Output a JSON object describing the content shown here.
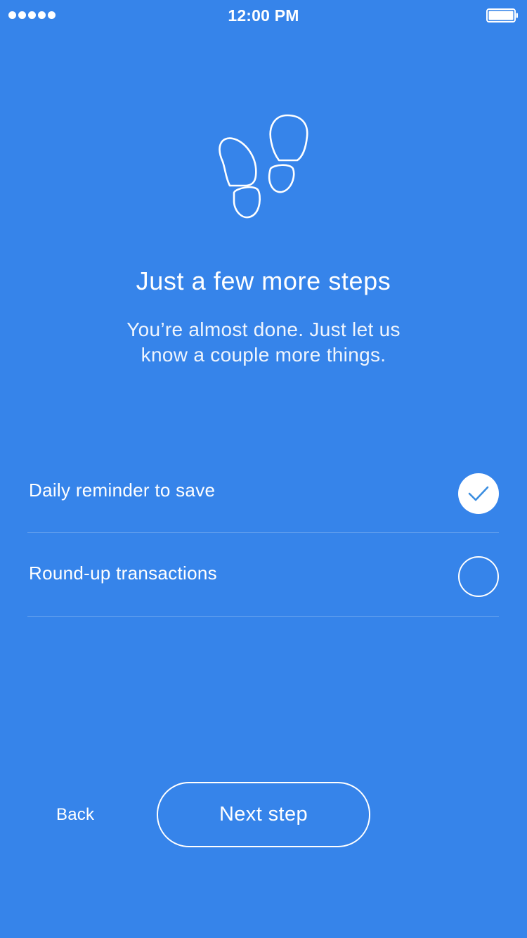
{
  "status_bar": {
    "time": "12:00 PM",
    "signal_dots": 5,
    "battery_icon": "battery-full-icon"
  },
  "hero": {
    "icon": "footprints-icon",
    "title": "Just a few more steps",
    "subtitle": "You’re almost done. Just let us know a couple more things."
  },
  "options": [
    {
      "label": "Daily reminder to save",
      "checked": true
    },
    {
      "label": "Round-up transactions",
      "checked": false
    }
  ],
  "footer": {
    "back_label": "Back",
    "next_label": "Next step"
  },
  "colors": {
    "background": "#3684ea",
    "foreground": "#ffffff",
    "check_accent": "#3a8de0"
  }
}
